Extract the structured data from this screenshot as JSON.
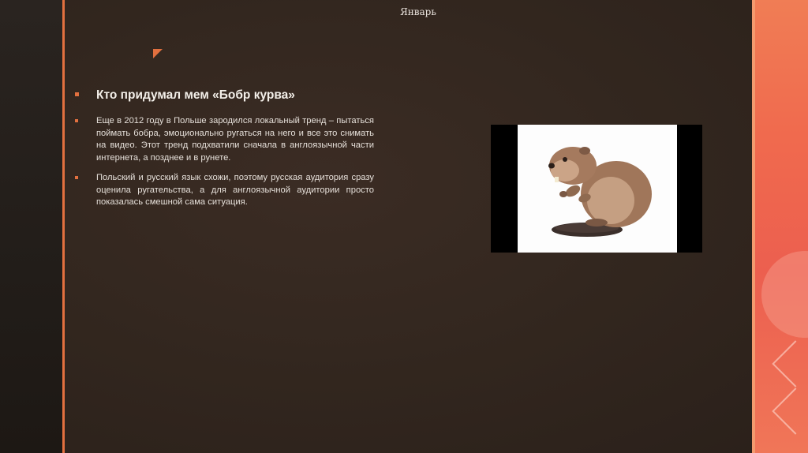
{
  "header": {
    "title": "Январь"
  },
  "main": {
    "heading": "Кто придумал мем «Бобр курва»",
    "paragraphs": [
      "Еще в 2012 году в Польше зародился локальный тренд – пытаться поймать бобра, эмоционально ругаться на него и все это снимать на видео. Этот тренд подхватили сначала в англоязычной части интернета, а позднее и в рунете.",
      "Польский и русский язык схожи, поэтому русская аудитория сразу оценила ругательства, а для англоязычной аудитории просто показалась смешной сама ситуация."
    ]
  },
  "image": {
    "icon": "beaver-icon"
  },
  "colors": {
    "background": "#33271f",
    "accent": "#e2703f",
    "right_strip": "#f06a4e",
    "text": "#e9e4de"
  }
}
